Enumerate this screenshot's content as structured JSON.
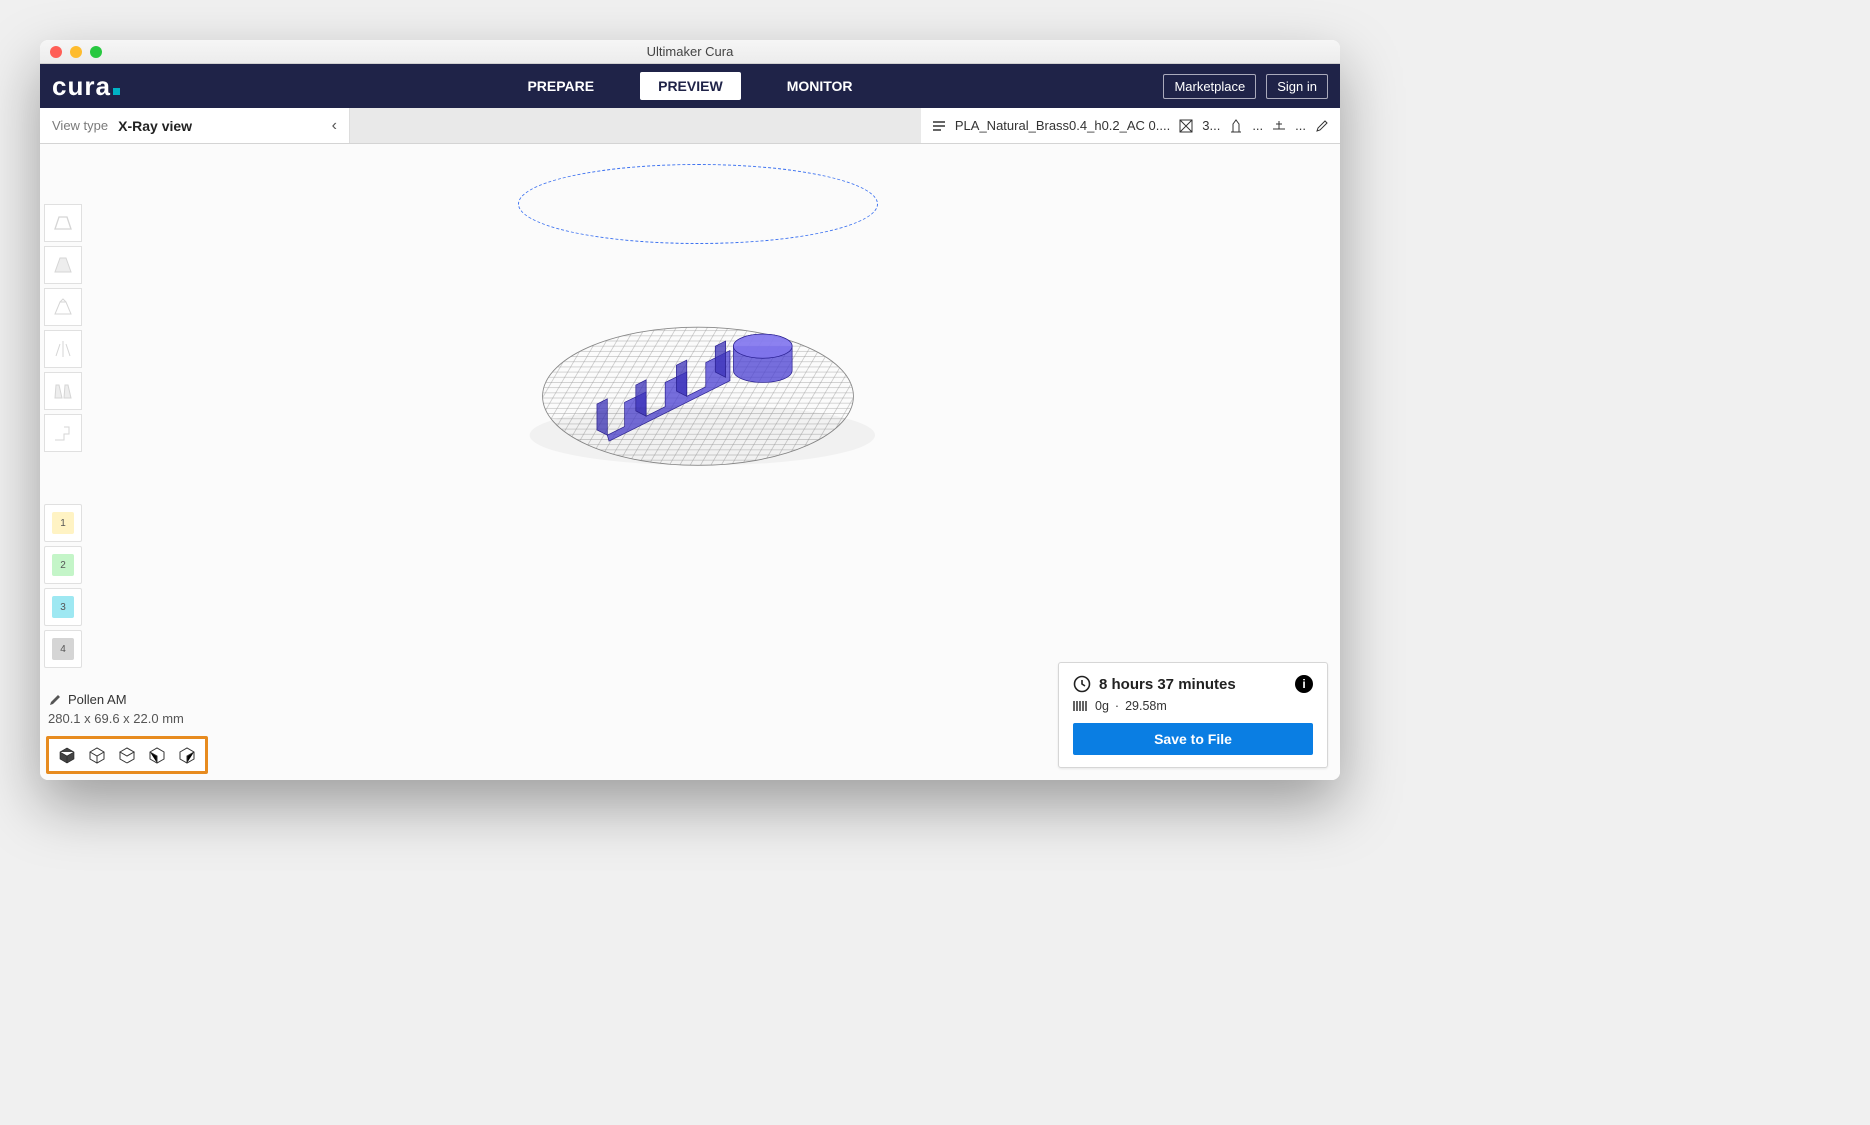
{
  "window": {
    "title": "Ultimaker Cura"
  },
  "logo": "cura",
  "nav": {
    "tabs": [
      "PREPARE",
      "PREVIEW",
      "MONITOR"
    ],
    "active": "PREVIEW",
    "marketplace": "Marketplace",
    "signin": "Sign in"
  },
  "viewtype": {
    "label": "View type",
    "value": "X-Ray view"
  },
  "settings": {
    "material": "PLA_Natural_Brass0.4_h0.2_AC 0....",
    "infill_text": "3...",
    "extra_text": "..."
  },
  "extruders": [
    "1",
    "2",
    "3",
    "4"
  ],
  "model": {
    "name": "Pollen AM",
    "dimensions": "280.1 x 69.6 x 22.0 mm"
  },
  "time": {
    "duration": "8 hours 37 minutes",
    "weight": "0g",
    "sep": "·",
    "length": "29.58m",
    "save": "Save to File"
  }
}
